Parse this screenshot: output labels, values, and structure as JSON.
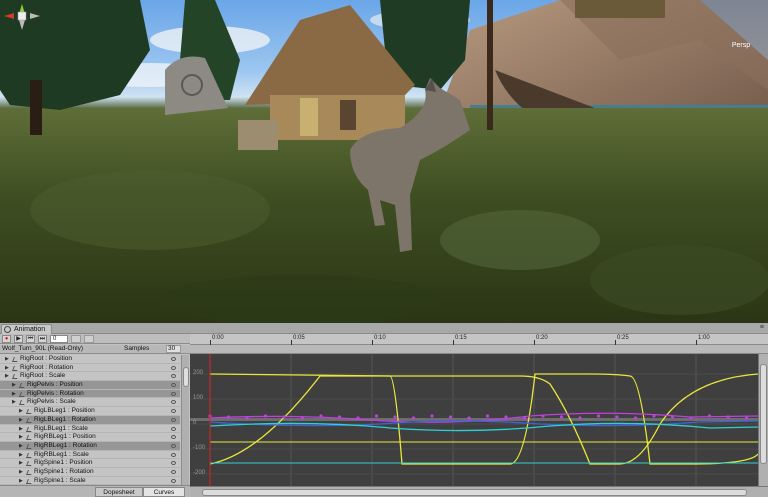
{
  "gizmo": {
    "label": "Persp"
  },
  "animation_window": {
    "tab_label": "Animation",
    "window_icons": "≡",
    "toolbar": {
      "record_icon": "●",
      "play_icon": "▶",
      "prev_key_icon": "⏮",
      "next_key_icon": "⏭",
      "frame_value": "0"
    },
    "clip_name": "Wolf_Turn_90L (Read-Only)",
    "samples_label": "Samples",
    "samples_value": "30",
    "properties": [
      {
        "label": "RigRoot : Position",
        "indent": 0,
        "selected": false
      },
      {
        "label": "RigRoot : Rotation",
        "indent": 0,
        "selected": false
      },
      {
        "label": "RigRoot : Scale",
        "indent": 0,
        "selected": false
      },
      {
        "label": "RigPelvis : Position",
        "indent": 1,
        "selected": true
      },
      {
        "label": "RigPelvis : Rotation",
        "indent": 1,
        "selected": true
      },
      {
        "label": "RigPelvis : Scale",
        "indent": 1,
        "selected": false
      },
      {
        "label": "RigLBLeg1 : Position",
        "indent": 2,
        "selected": false
      },
      {
        "label": "RigLBLeg1 : Rotation",
        "indent": 2,
        "selected": true
      },
      {
        "label": "RigLBLeg1 : Scale",
        "indent": 2,
        "selected": false
      },
      {
        "label": "RigRBLeg1 : Position",
        "indent": 2,
        "selected": false
      },
      {
        "label": "RigRBLeg1 : Rotation",
        "indent": 2,
        "selected": true
      },
      {
        "label": "RigRBLeg1 : Scale",
        "indent": 2,
        "selected": false
      },
      {
        "label": "RigSpine1 : Position",
        "indent": 2,
        "selected": false
      },
      {
        "label": "RigSpine1 : Rotation",
        "indent": 2,
        "selected": false
      },
      {
        "label": "RigSpine1 : Scale",
        "indent": 2,
        "selected": false
      }
    ],
    "bottom_tabs": {
      "dopesheet": "Dopesheet",
      "curves": "Curves"
    },
    "timeline_ticks": [
      "0:00",
      "0:05",
      "0:10",
      "0:15",
      "0:20",
      "0:25",
      "1:00"
    ],
    "y_labels": [
      "200",
      "100",
      "0",
      "-100",
      "-200"
    ],
    "colors": {
      "curve_yellow": "#e8e83a",
      "curve_magenta": "#c040e0",
      "curve_cyan": "#30d0d0",
      "curve_blue": "#4060e0",
      "curve_bg": "#3f3f3f",
      "playhead": "#e02020"
    }
  }
}
